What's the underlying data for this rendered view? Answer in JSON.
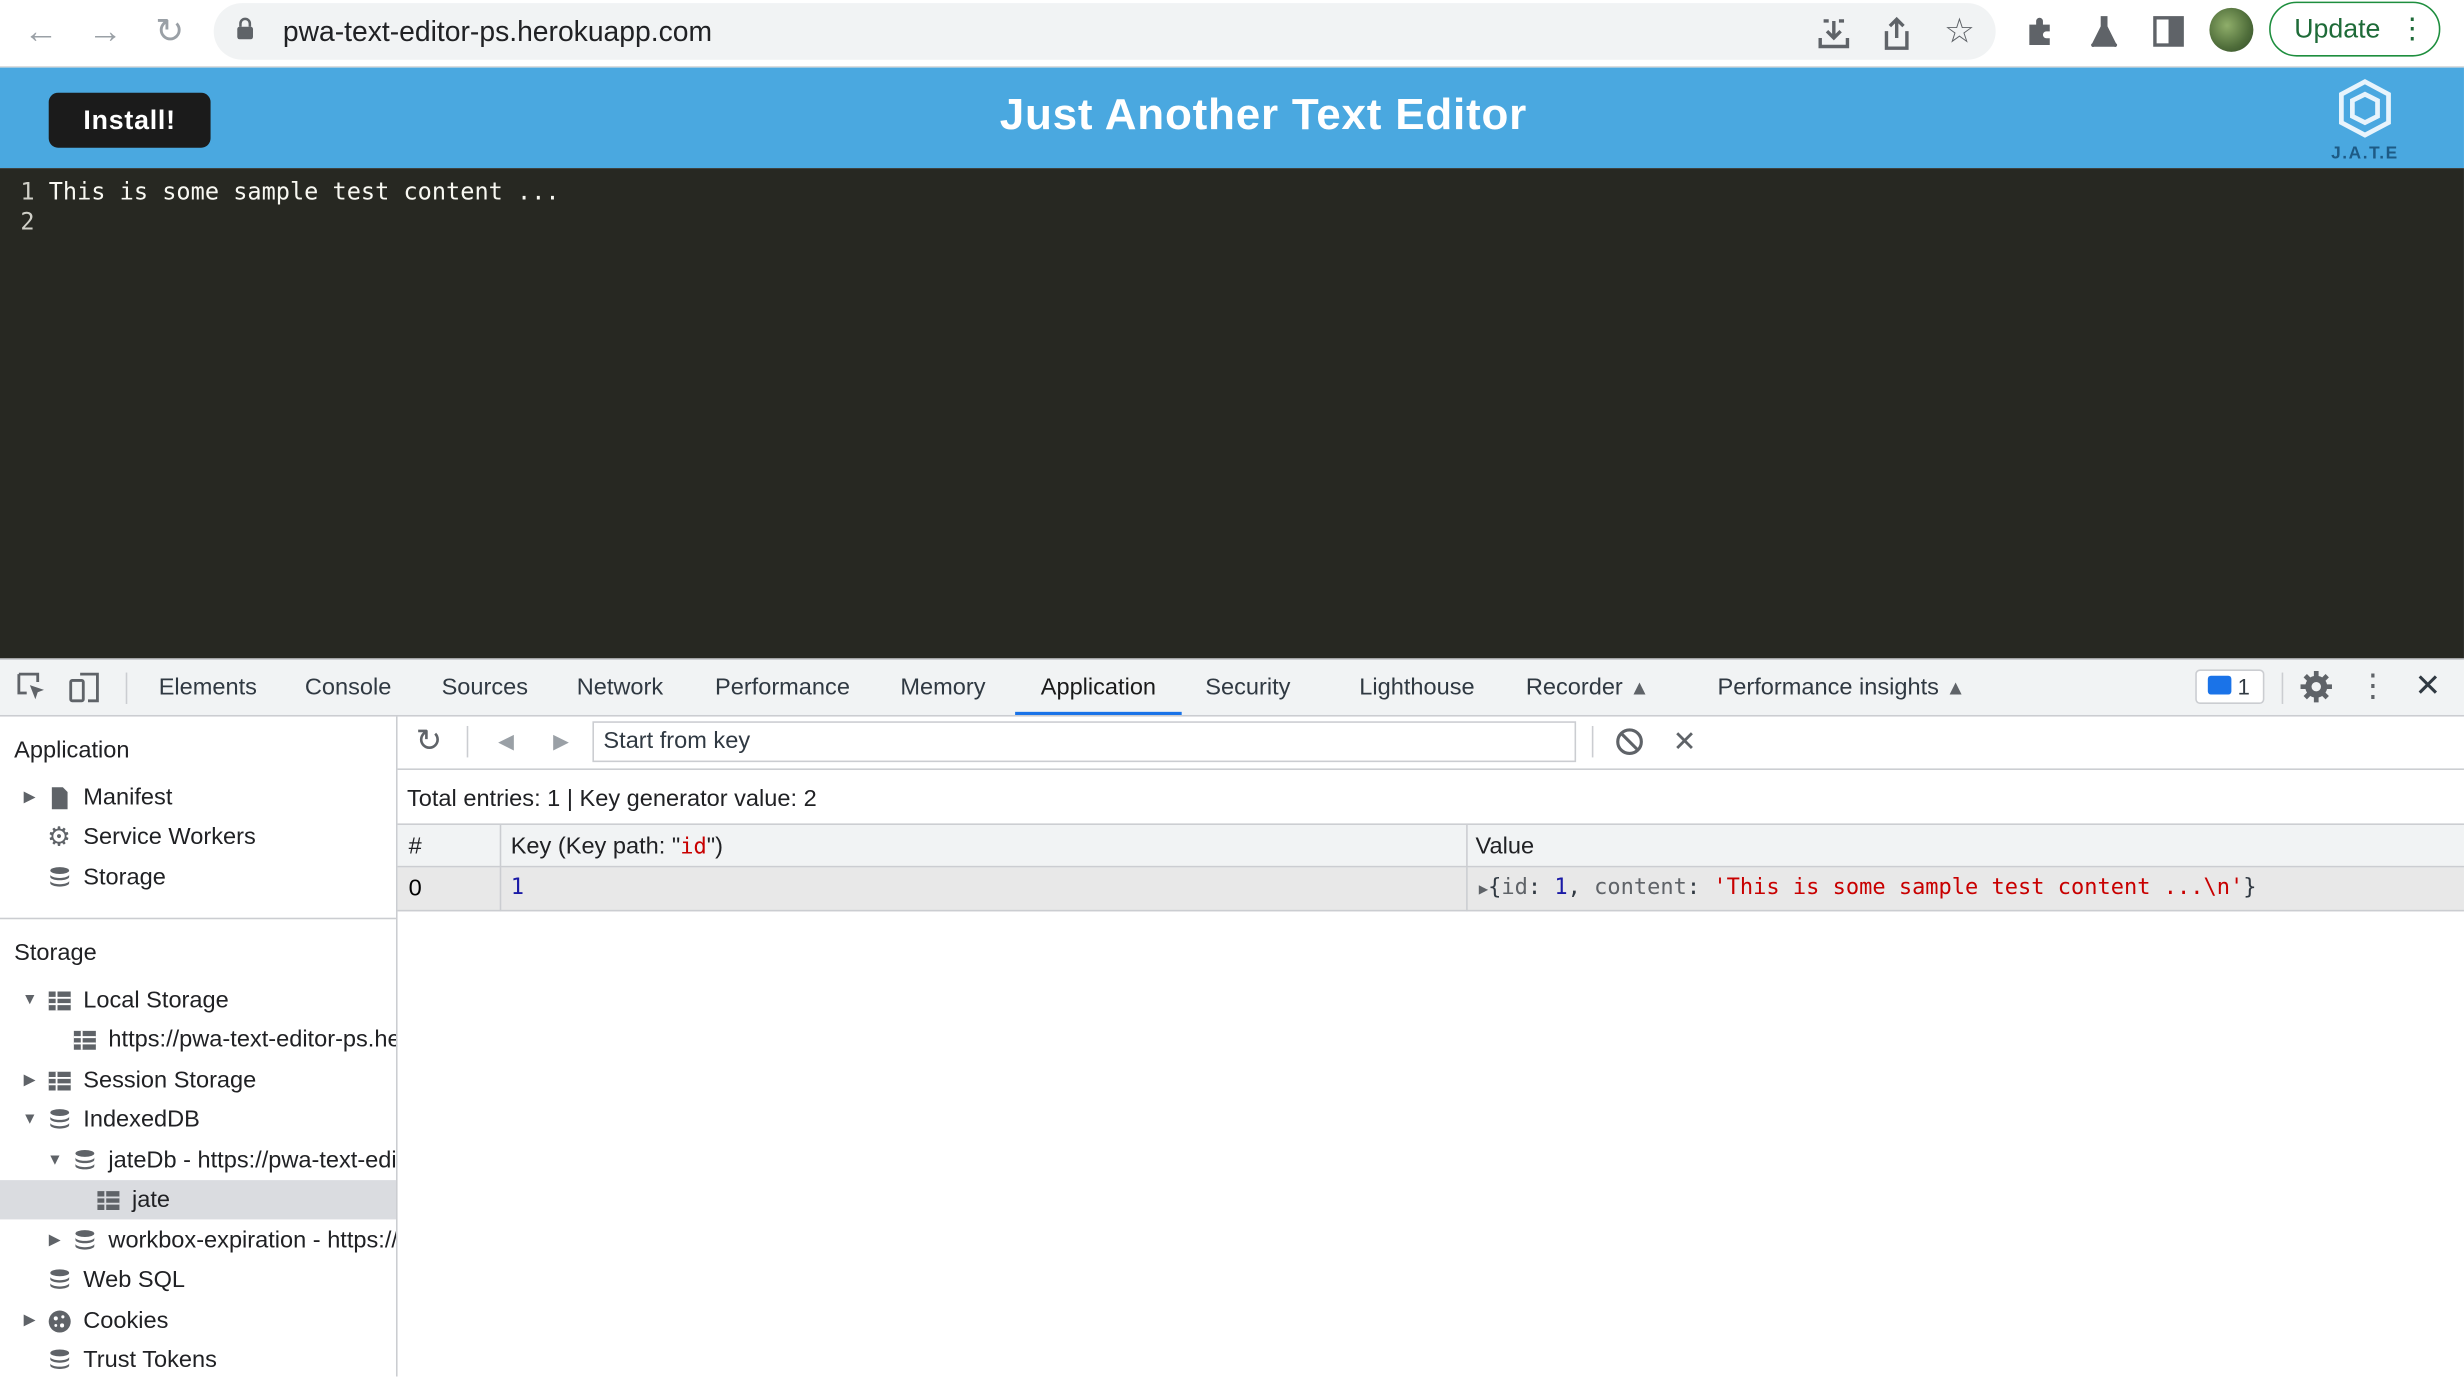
{
  "browser": {
    "url": "pwa-text-editor-ps.herokuapp.com",
    "update_label": "Update"
  },
  "app": {
    "install_label": "Install!",
    "title": "Just Another Text Editor",
    "logo_text": "J.A.T.E",
    "header_color": "#4aa8e0"
  },
  "editor": {
    "lines": [
      {
        "num": "1",
        "text": "This is some sample test content ..."
      },
      {
        "num": "2",
        "text": ""
      }
    ],
    "background": "#272822"
  },
  "devtools": {
    "tabs": [
      "Elements",
      "Console",
      "Sources",
      "Network",
      "Performance",
      "Memory",
      "Application",
      "Security",
      "Lighthouse",
      "Recorder",
      "Performance insights"
    ],
    "active_tab": "Application",
    "issues_count": "1",
    "sidebar": {
      "application_heading": "Application",
      "application_items": [
        "Manifest",
        "Service Workers",
        "Storage"
      ],
      "storage_heading": "Storage",
      "storage_items": [
        "Local Storage",
        "https://pwa-text-editor-ps.herokuapp.com",
        "Session Storage",
        "IndexedDB",
        "jateDb - https://pwa-text-editor-ps.herokuapp.com",
        "jate",
        "workbox-expiration - https://pwa-text-editor-ps.herokuapp.com",
        "Web SQL",
        "Cookies",
        "Trust Tokens"
      ],
      "selected_item": "jate"
    },
    "main": {
      "start_key_placeholder": "Start from key",
      "summary": "Total entries: 1 | Key generator value: 2",
      "columns": {
        "index": "#",
        "key_prefix": "Key (Key path: \"",
        "key_path": "id",
        "key_suffix": "\")",
        "value": "Value"
      },
      "rows": [
        {
          "index": "0",
          "key": "1",
          "value_open": "{",
          "value_id_key": "id",
          "value_id": "1",
          "value_content_key": "content",
          "value_content": "'This is some sample test content ...\\n'",
          "value_close": "}"
        }
      ]
    }
  }
}
